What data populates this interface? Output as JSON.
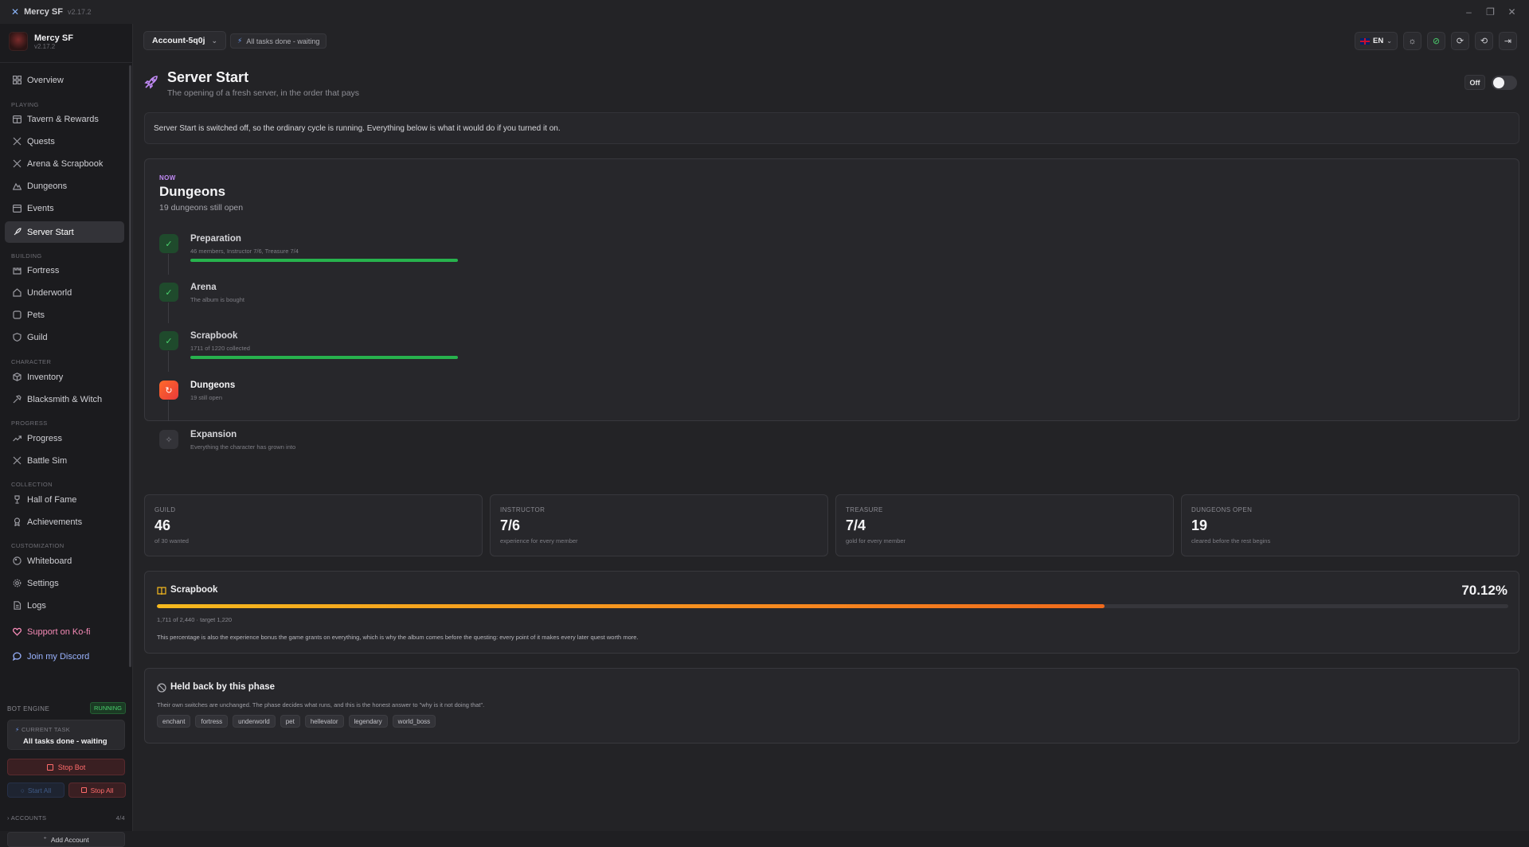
{
  "window": {
    "title": "Mercy SF",
    "version": "v2.17.2"
  },
  "sidebar": {
    "brand": {
      "name": "Mercy SF",
      "version": "v2.17.2"
    },
    "overview": "Overview",
    "sections": {
      "playing": "PLAYING",
      "building": "BUILDING",
      "character": "CHARACTER",
      "progress": "PROGRESS",
      "collection": "COLLECTION",
      "customization": "CUSTOMIZATION"
    },
    "items": {
      "tavern": "Tavern & Rewards",
      "quests": "Quests",
      "arena": "Arena & Scrapbook",
      "dungeons": "Dungeons",
      "events": "Events",
      "server_start": "Server Start",
      "fortress": "Fortress",
      "underworld": "Underworld",
      "pets": "Pets",
      "guild": "Guild",
      "inventory": "Inventory",
      "blacksmith": "Blacksmith & Witch",
      "progress": "Progress",
      "battle_sim": "Battle Sim",
      "hall_of_fame": "Hall of Fame",
      "achievements": "Achievements",
      "whiteboard": "Whiteboard",
      "settings": "Settings",
      "logs": "Logs",
      "kofi": "Support on Ko-fi",
      "discord": "Join my Discord"
    },
    "bot": {
      "header": "BOT ENGINE",
      "status": "RUNNING",
      "current_task_label": "CURRENT TASK",
      "current_task": "All tasks done - waiting",
      "stop_bot": "Stop Bot",
      "start_all": "Start All",
      "stop_all": "Stop All",
      "accounts_label": "ACCOUNTS",
      "accounts_count": "4/4",
      "add_account": "Add Account"
    }
  },
  "topbar": {
    "account": "Account-5q0j",
    "status": "All tasks done - waiting",
    "lang": "EN"
  },
  "page": {
    "title": "Server Start",
    "subtitle": "The opening of a fresh server, in the order that pays",
    "toggle_label": "Off",
    "toggle_on": false,
    "banner": "Server Start is switched off, so the ordinary cycle is running. Everything below is what it would do if you turned it on."
  },
  "phase": {
    "now_label": "NOW",
    "title": "Dungeons",
    "subtitle": "19 dungeons still open",
    "steps": [
      {
        "name": "Preparation",
        "desc": "46 members, Instructor 7/6, Treasure 7/4",
        "state": "done",
        "bar": true
      },
      {
        "name": "Arena",
        "desc": "The album is bought",
        "state": "done",
        "bar": false
      },
      {
        "name": "Scrapbook",
        "desc": "1711 of 1220 collected",
        "state": "done",
        "bar": true
      },
      {
        "name": "Dungeons",
        "desc": "19 still open",
        "state": "current",
        "bar": false
      },
      {
        "name": "Expansion",
        "desc": "Everything the character has grown into",
        "state": "waiting",
        "bar": false
      }
    ]
  },
  "stats": [
    {
      "label": "GUILD",
      "value": "46",
      "desc": "of 30 wanted"
    },
    {
      "label": "INSTRUCTOR",
      "value": "7/6",
      "desc": "experience for every member"
    },
    {
      "label": "TREASURE",
      "value": "7/4",
      "desc": "gold for every member"
    },
    {
      "label": "DUNGEONS OPEN",
      "value": "19",
      "desc": "cleared before the rest begins"
    }
  ],
  "scrapbook": {
    "title": "Scrapbook",
    "percent": "70.12%",
    "progress": 0.7012,
    "meta": "1,711 of 2,440 · target 1,220",
    "note": "This percentage is also the experience bonus the game grants on everything, which is why the album comes before the questing: every point of it makes every later quest worth more."
  },
  "held": {
    "title": "Held back by this phase",
    "note": "Their own switches are unchanged. The phase decides what runs, and this is the honest answer to \"why is it not doing that\".",
    "chips": [
      "enchant",
      "fortress",
      "underworld",
      "pet",
      "hellevator",
      "legendary",
      "world_boss"
    ]
  },
  "colors": {
    "accent": "#c18af5",
    "done": "#27b24d",
    "current": "#ff6a2a",
    "progress": "#f6861f"
  }
}
